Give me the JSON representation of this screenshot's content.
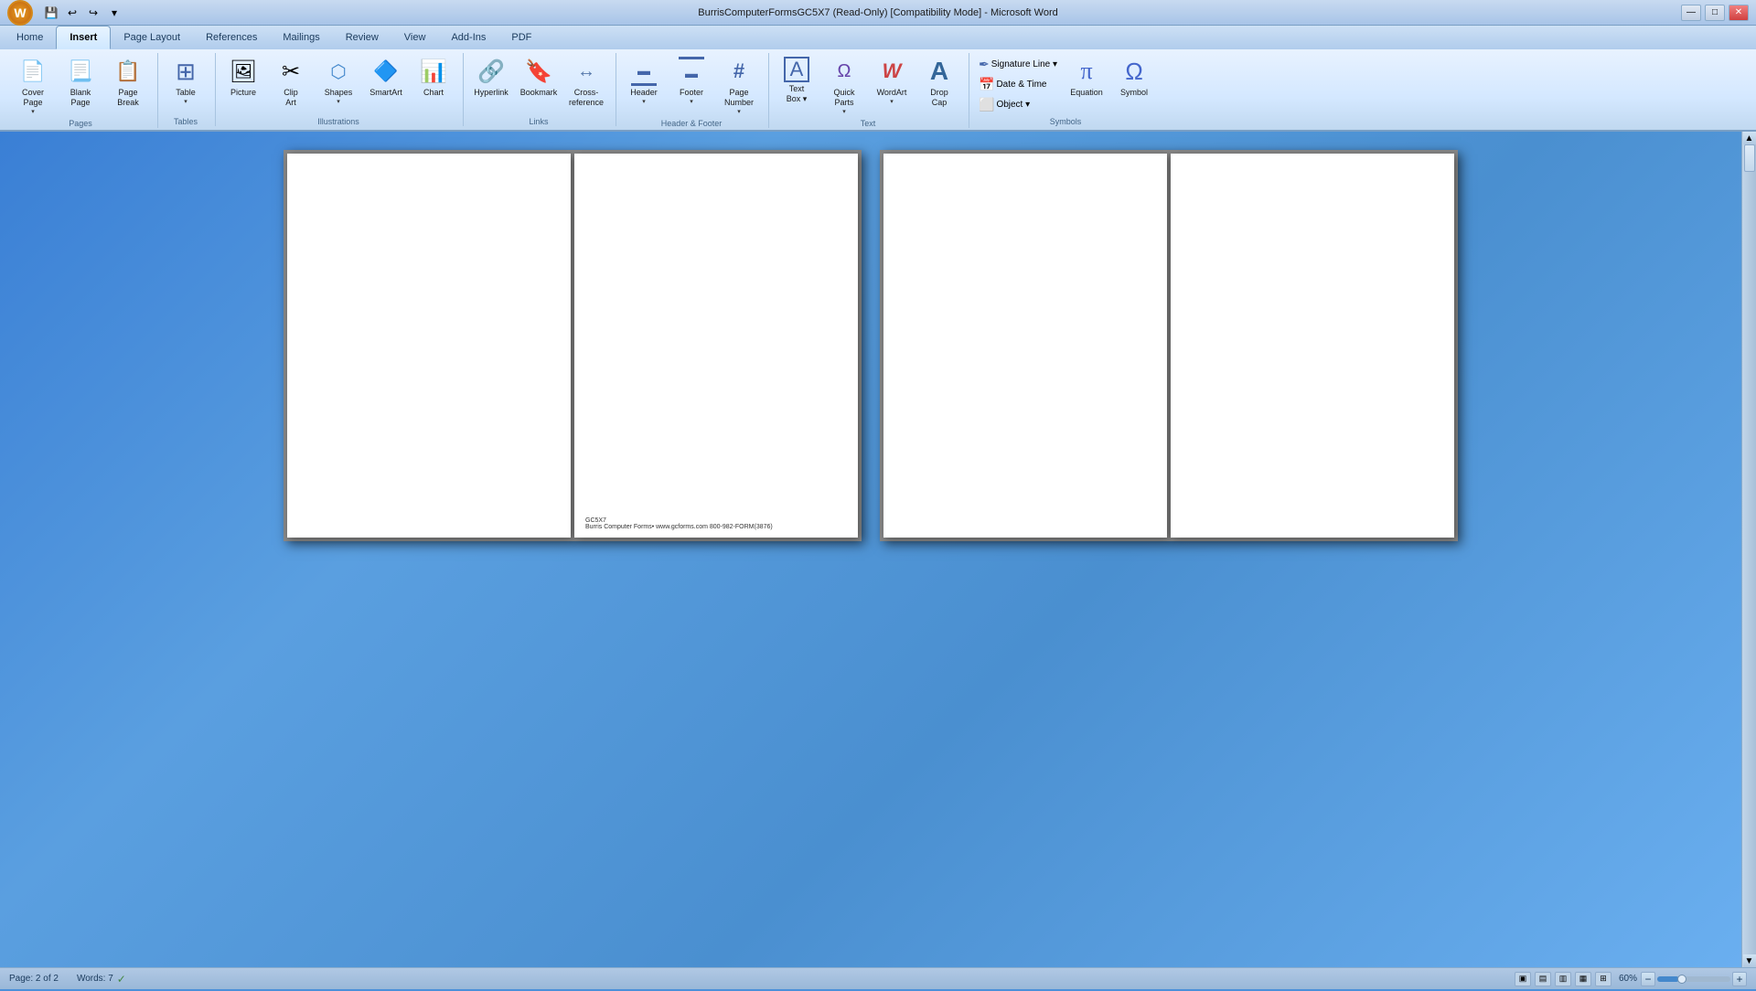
{
  "titlebar": {
    "title": "BurrisComputerFormsGC5X7 (Read-Only) [Compatibility Mode] - Microsoft Word",
    "min_label": "—",
    "max_label": "□",
    "close_label": "✕"
  },
  "quickaccess": {
    "save_icon": "💾",
    "undo_icon": "↩",
    "redo_icon": "↪",
    "dropdown_icon": "▾"
  },
  "tabs": [
    {
      "label": "Home",
      "active": false
    },
    {
      "label": "Insert",
      "active": true
    },
    {
      "label": "Page Layout",
      "active": false
    },
    {
      "label": "References",
      "active": false
    },
    {
      "label": "Mailings",
      "active": false
    },
    {
      "label": "Review",
      "active": false
    },
    {
      "label": "View",
      "active": false
    },
    {
      "label": "Add-Ins",
      "active": false
    },
    {
      "label": "PDF",
      "active": false
    }
  ],
  "ribbon": {
    "groups": [
      {
        "label": "Pages",
        "items": [
          {
            "type": "large",
            "icon": "📄",
            "label": "Cover\nPage",
            "name": "cover-page"
          },
          {
            "type": "large",
            "icon": "📃",
            "label": "Blank\nPage",
            "name": "blank-page"
          },
          {
            "type": "large",
            "icon": "📋",
            "label": "Page\nBreak",
            "name": "page-break"
          }
        ]
      },
      {
        "label": "Tables",
        "items": [
          {
            "type": "large",
            "icon": "⊞",
            "label": "Table",
            "name": "table",
            "dropdown": true
          }
        ]
      },
      {
        "label": "Illustrations",
        "items": [
          {
            "type": "large",
            "icon": "🖼",
            "label": "Picture",
            "name": "picture"
          },
          {
            "type": "large",
            "icon": "✂",
            "label": "Clip\nArt",
            "name": "clip-art"
          },
          {
            "type": "large",
            "icon": "⬡",
            "label": "Shapes",
            "name": "shapes",
            "dropdown": true
          },
          {
            "type": "large",
            "icon": "🔷",
            "label": "SmartArt",
            "name": "smart-art"
          },
          {
            "type": "large",
            "icon": "📊",
            "label": "Chart",
            "name": "chart"
          }
        ]
      },
      {
        "label": "Links",
        "items": [
          {
            "type": "large",
            "icon": "🔗",
            "label": "Hyperlink",
            "name": "hyperlink"
          },
          {
            "type": "large",
            "icon": "🔖",
            "label": "Bookmark",
            "name": "bookmark"
          },
          {
            "type": "large",
            "icon": "↔",
            "label": "Cross-reference",
            "name": "cross-reference"
          }
        ]
      },
      {
        "label": "Header & Footer",
        "items": [
          {
            "type": "large",
            "icon": "▬",
            "label": "Header",
            "name": "header",
            "dropdown": true
          },
          {
            "type": "large",
            "icon": "▬",
            "label": "Footer",
            "name": "footer",
            "dropdown": true
          },
          {
            "type": "large",
            "icon": "#",
            "label": "Page\nNumber",
            "name": "page-number",
            "dropdown": true
          }
        ]
      },
      {
        "label": "Text",
        "items": [
          {
            "type": "large",
            "icon": "A",
            "label": "Text\nBox ▾",
            "name": "text-box",
            "dropdown": true
          },
          {
            "type": "large",
            "icon": "Ω",
            "label": "Quick\nParts",
            "name": "quick-parts",
            "dropdown": true
          },
          {
            "type": "large",
            "icon": "W",
            "label": "WordArt",
            "name": "word-art",
            "dropdown": true
          },
          {
            "type": "large",
            "icon": "A",
            "label": "Drop\nCap",
            "name": "drop-cap"
          }
        ]
      },
      {
        "label": "Symbols",
        "items": [
          {
            "type": "stack",
            "items": [
              {
                "icon": "∫",
                "label": "Signature Line ▾",
                "name": "signature-line"
              },
              {
                "icon": "📅",
                "label": "Date & Time",
                "name": "date-time"
              },
              {
                "icon": "⬜",
                "label": "Object ▾",
                "name": "object"
              }
            ]
          },
          {
            "type": "large",
            "icon": "π",
            "label": "Equation",
            "name": "equation"
          },
          {
            "type": "large",
            "icon": "Ω",
            "label": "Symbol",
            "name": "symbol"
          }
        ]
      }
    ]
  },
  "document": {
    "pages": [
      {
        "id": 1,
        "has_footer": false,
        "content": ""
      },
      {
        "id": 2,
        "has_footer": true,
        "footer_line1": "GC5X7",
        "footer_line2": "Burris Computer Forms• www.gcforms.com 800-982-FORM(3876)"
      },
      {
        "id": 3,
        "has_footer": false,
        "content": ""
      },
      {
        "id": 4,
        "has_footer": false,
        "content": ""
      }
    ]
  },
  "statusbar": {
    "page_label": "Page: 2 of 2",
    "words_label": "Words: 7",
    "check_icon": "✓",
    "view_icons": [
      "▣",
      "▤",
      "▥",
      "▦",
      "⊞"
    ],
    "zoom_level": "60%",
    "zoom_minus": "−",
    "zoom_plus": "+"
  }
}
